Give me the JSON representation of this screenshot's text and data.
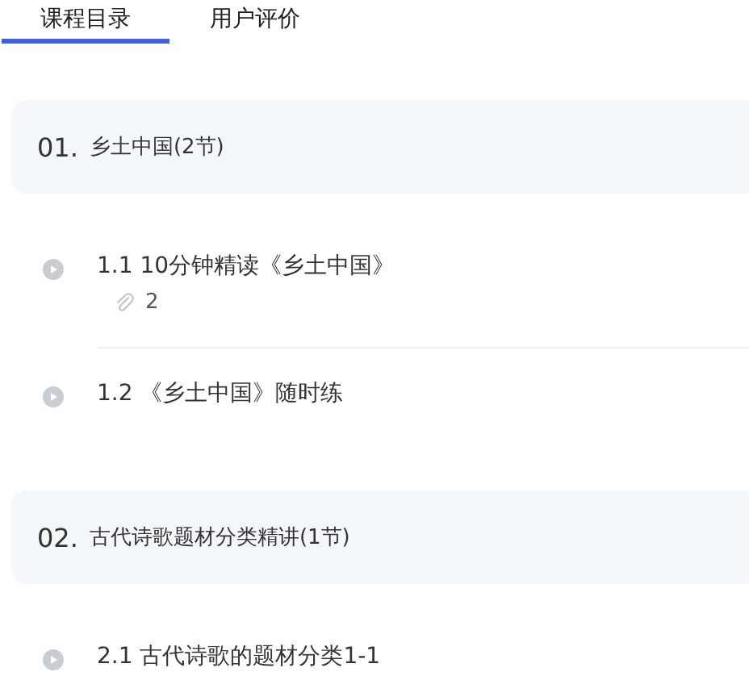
{
  "tabs": [
    {
      "label": "课程目录",
      "selected": true
    },
    {
      "label": "用户评价",
      "selected": false
    }
  ],
  "chapters": [
    {
      "number": "01.",
      "title": "乡土中国(2节)",
      "lessons": [
        {
          "title": "1.1 10分钟精读《乡土中国》",
          "attachments": "2"
        },
        {
          "title": "1.2 《乡土中国》随时练"
        }
      ]
    },
    {
      "number": "02.",
      "title": "古代诗歌题材分类精讲(1节)",
      "lessons": [
        {
          "title": "2.1 古代诗歌的题材分类1-1"
        }
      ]
    }
  ]
}
